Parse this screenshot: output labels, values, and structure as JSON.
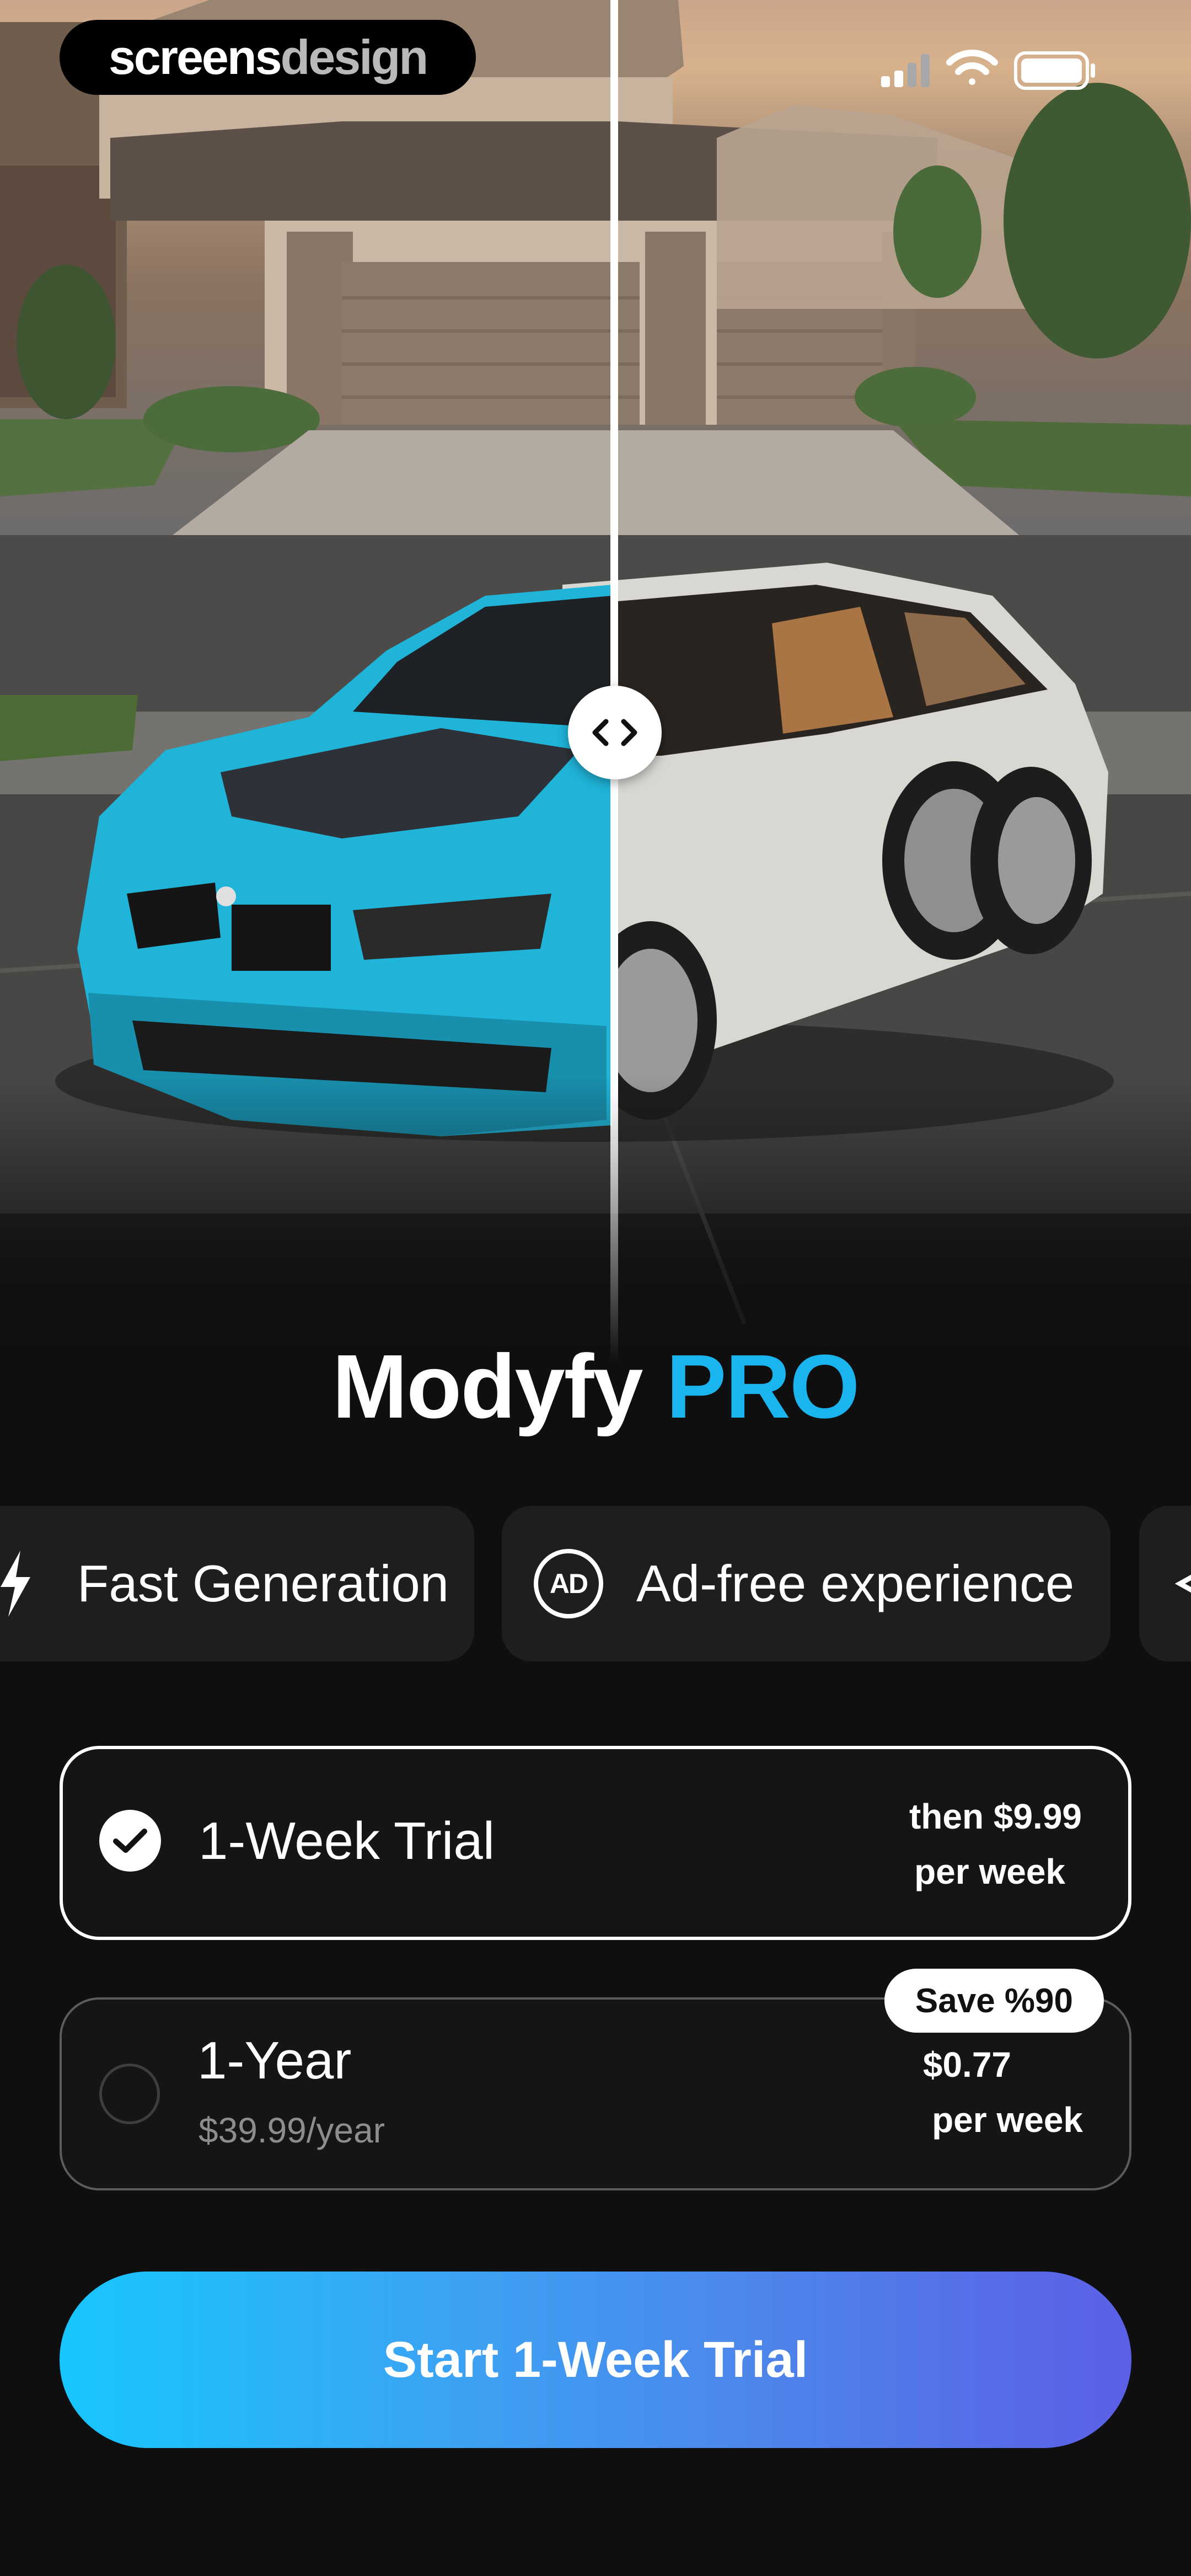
{
  "brand": {
    "part1": "screens",
    "part2": "design"
  },
  "status_bar": {
    "signal_icon": "cellular-signal-icon",
    "wifi_icon": "wifi-icon",
    "battery_icon": "battery-icon"
  },
  "comparison": {
    "handle_icon": "chevron-left-right-icon"
  },
  "title": {
    "name": "Modyfy",
    "tier": "PRO",
    "tier_color": "#1ab4ee"
  },
  "features": [
    {
      "label": "Fast Generation",
      "icon": "lightning-icon"
    },
    {
      "label": "Ad-free experience",
      "icon": "ad-free-icon",
      "icon_text": "AD"
    },
    {
      "label": "",
      "icon": "arrow-icon"
    }
  ],
  "plans": [
    {
      "name": "1-Week Trial",
      "price_line1": "then $9.99",
      "price_line2": "per week",
      "selected": true
    },
    {
      "name": "1-Year",
      "subtitle": "$39.99/year",
      "price_line1": "$0.77",
      "price_line2": "per week",
      "badge": "Save %90",
      "selected": false
    }
  ],
  "cta": {
    "label": "Start 1-Week Trial"
  },
  "colors": {
    "background": "#0f0f10",
    "accent": "#1ab4ee",
    "gradient_start": "#17c6ff",
    "gradient_end": "#5b5fe6"
  }
}
